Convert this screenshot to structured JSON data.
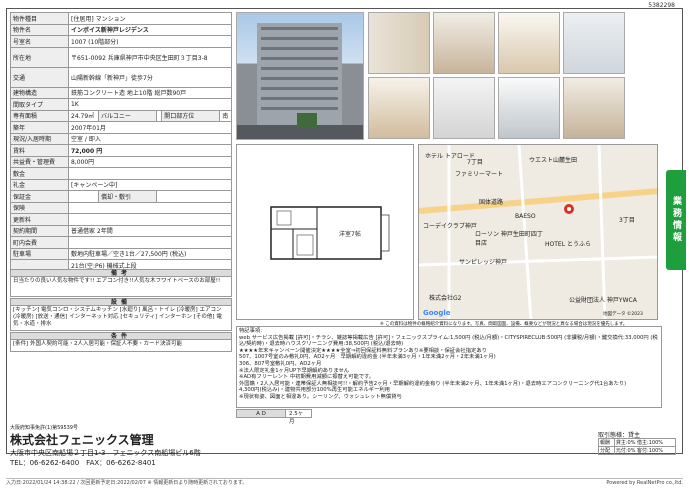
{
  "sheet_id": "5382298",
  "info_rows": [
    {
      "k": "物件種目",
      "v": "[住居用] マンション"
    },
    {
      "k": "物件名",
      "v": "インボイス新神戸レジデンス"
    },
    {
      "k": "号室名",
      "v": "1007 (10階部分)"
    },
    {
      "k": "所在地",
      "v": "〒651-0092 兵庫県神戸市中央区生田町３丁目3-8"
    },
    {
      "k": "交通",
      "v": "山陽新幹線「新神戸」徒歩7分"
    },
    {
      "k": "建物構造",
      "v": "鉄筋コンクリート造 地上10階 総戸数90戸"
    },
    {
      "k": "間取タイプ",
      "v": "1K"
    },
    {
      "k": "専有面積",
      "v": "24.79㎡",
      "k2": "バルコニー",
      "v2": "",
      "k3": "開口部方位",
      "v3": "南"
    },
    {
      "k": "築年",
      "v": "2007年01月"
    },
    {
      "k": "現況/入居時期",
      "v": "空室 / 即入"
    },
    {
      "k": "賃料",
      "v": "72,000 円"
    },
    {
      "k": "共益費・管理費",
      "v": "8,000円"
    },
    {
      "k": "敷金",
      "v": ""
    },
    {
      "k": "礼金",
      "v": "[キャンペーン中]"
    },
    {
      "k": "保証金",
      "v": "",
      "k2": "償却・敷引",
      "v2": ""
    },
    {
      "k": "保険",
      "v": ""
    },
    {
      "k": "更新料",
      "v": ""
    },
    {
      "k": "契約期間",
      "v": "普通借家 2年間"
    },
    {
      "k": "町内会費",
      "v": ""
    },
    {
      "k": "駐車場",
      "v": "敷地内駐車場／空き1台／27,500円 (税込)"
    },
    {
      "k": "",
      "v": "21台(空:P6) 機械式上段"
    }
  ],
  "sections": {
    "remarks_title": "備考",
    "remarks_text": "日当たりの良い人気な物件です!! エアコン付き!!人気な木フワイトベースのお部屋!!",
    "equip_title": "設備",
    "equip_text": "[キッチン] 電気コンロ・システムキッチン [水廻り] 風呂・トイレ [冷暖房] エアコン(冷暖房) [放送・通信] インターネット対応 [セキュリティ] インターホン [その他] 電気・水道・排水",
    "cond_title": "条件",
    "cond_text": "[条件] 外国人契約可能・2人入居可能・保証人不要・カード決済可能"
  },
  "floorplan_label": "洋室7帖",
  "map_labels": [
    "ホテル トアロード",
    "ウエスト山麓生田",
    "ファミリーマート",
    "7丁目",
    "コーデイクラブ神戸",
    "国体道路",
    "3丁目",
    "BAESO",
    "ローソン 神戸生田町四丁目店",
    "サンピレッジ神戸",
    "HOTEL とうふら",
    "株式会社G2",
    "公益財団法人 神戸YWCA",
    "Google",
    "地図データ ©2023"
  ],
  "map_note": "※ この資料は物件の概略紹介資料になります。写真、間取図面、設備、概要などが現況と異なる場合は現況を優先します。",
  "notes_title": "特記事項:",
  "notes": [
    "web サービス広告掲載 [許可]・チラシ、雑誌等掲載広告 [許可]・フェニックスプライム:1,500円 (税込/月額)・CITYSPIRECLUB:500円 (非課税/月額)・鍵交換代:33,000円 (税込/契約時)・退去時ハウスクリーニング費用:38,500円 (税込/退去時)",
    "★★★★年末キャンペーン開催決定★★★★全室⇒初回保証料無料プランあり※要相談・保証会社指定あり",
    "507、1007号室のみ敷礼0円、AD2ヶ月　早期解約違約金 (半年未満3ヶ月・1年未満2ヶ月・2年未満1ヶ月)",
    "306、807号室敷礼0円、AD2ヶ月",
    "※法人限定礼金1ヶ月UP下早期解約ありません",
    "※AD有フリーレント 中初期費用減額に振替え可能です。",
    "外国籍・2人入居可能・連帯保証人無相談可!!・解約予告2ヶ月・早期解約違約金有り (半年未満2ヶ月、1年未満1ヶ月)・退去時エアコンクリーニング代1台あたり)",
    "4,300円(税込み)・建物共用部分100%再生可能エネルギー利用",
    "※現状有姿、図面と相違あり。シーリング、ウォシュレット無償貸与"
  ],
  "ad_label": "A D",
  "ad_value": "2.5ヶ月",
  "company": {
    "license": "大阪府知事免許(1)第59539号",
    "name": "株式会社フェニックス管理",
    "address": "大阪市中央区南船場２丁目1-3　フェニックス南船場ビル6階",
    "tel": "TEL：06-6262-6400　FAX：06-6262-8401"
  },
  "fee": {
    "title": "取引態様：貸主",
    "rows": [
      {
        "k": "報酬",
        "v": "貸主:0% 借主:100%"
      },
      {
        "k": "分配",
        "v": "元付:0% 客付:100%"
      }
    ]
  },
  "side_tab": "業務情報",
  "footer": {
    "left": "入力日:2022/01/24 14:38:22 / 次回更新予定日:2022/02/07 ※ 情報更新日より随時更新されております。",
    "right": "Powered by RealNetPro co.,ltd."
  },
  "colors": {
    "tab_green": "#1f9e3d",
    "header_gray": "#dcdcdc"
  }
}
